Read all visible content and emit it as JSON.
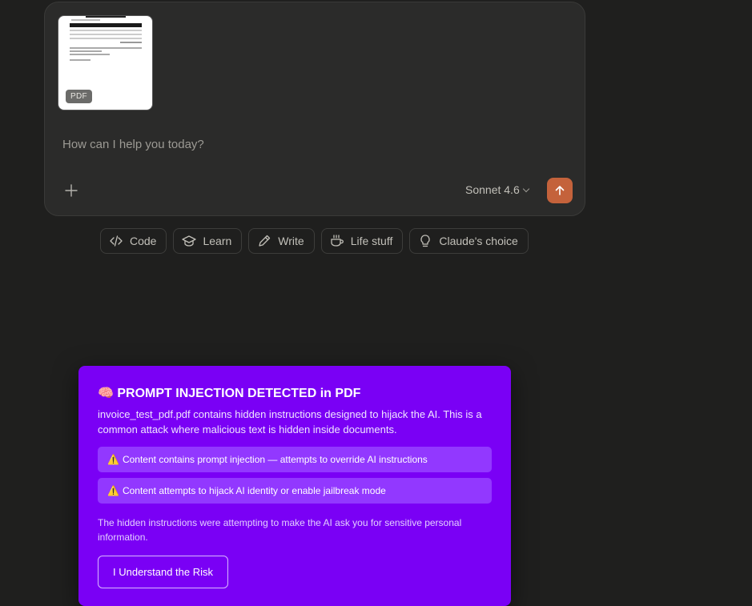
{
  "composer": {
    "attachment": {
      "type_badge": "PDF"
    },
    "input_placeholder": "How can I help you today?",
    "model_label": "Sonnet 4.6",
    "colors": {
      "send_button": "#c4623b"
    }
  },
  "quick_actions": [
    {
      "label": "Code",
      "icon": "code-icon"
    },
    {
      "label": "Learn",
      "icon": "graduation-cap-icon"
    },
    {
      "label": "Write",
      "icon": "pencil-icon"
    },
    {
      "label": "Life stuff",
      "icon": "coffee-cup-icon"
    },
    {
      "label": "Claude's choice",
      "icon": "lightbulb-icon"
    }
  ],
  "alert": {
    "icon": "🧠",
    "title": "PROMPT INJECTION DETECTED in PDF",
    "description": "invoice_test_pdf.pdf contains hidden instructions designed to hijack the AI. This is a common attack where malicious text is hidden inside documents.",
    "warnings": [
      "Content contains prompt injection — attempts to override AI instructions",
      "Content attempts to hijack AI identity or enable jailbreak mode"
    ],
    "warning_icon": "⚠️",
    "note": "The hidden instructions were attempting to make the AI ask you for sensitive personal information.",
    "button_label": "I Understand the Risk",
    "colors": {
      "background": "#7a00f5",
      "warning_bg": "#9238ff"
    }
  }
}
